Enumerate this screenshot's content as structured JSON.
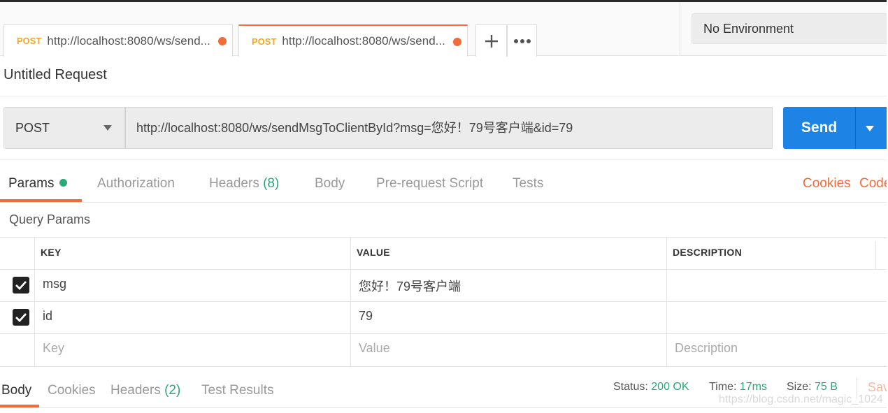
{
  "tabs": [
    {
      "method": "POST",
      "url": "http://localhost:8080/ws/send..."
    },
    {
      "method": "POST",
      "url": "http://localhost:8080/ws/send..."
    }
  ],
  "environment": {
    "selected": "No Environment"
  },
  "request": {
    "title": "Untitled Request",
    "method": "POST",
    "url": "http://localhost:8080/ws/sendMsgToClientById?msg=您好！79号客户端&id=79",
    "send_label": "Send"
  },
  "request_tabs": {
    "params": "Params",
    "authorization": "Authorization",
    "headers": "Headers",
    "headers_count": "(8)",
    "body": "Body",
    "prerequest": "Pre-request Script",
    "tests": "Tests",
    "cookies": "Cookies",
    "code": "Code"
  },
  "query_params": {
    "title": "Query Params",
    "columns": {
      "key": "KEY",
      "value": "VALUE",
      "description": "DESCRIPTION"
    },
    "rows": [
      {
        "checked": true,
        "key": "msg",
        "value": "您好！79号客户端",
        "description": ""
      },
      {
        "checked": true,
        "key": "id",
        "value": "79",
        "description": ""
      }
    ],
    "placeholders": {
      "key": "Key",
      "value": "Value",
      "description": "Description"
    }
  },
  "response": {
    "tabs": {
      "body": "Body",
      "cookies": "Cookies",
      "headers": "Headers",
      "headers_count": "(2)",
      "test_results": "Test Results"
    },
    "status_label": "Status:",
    "status_value": "200 OK",
    "time_label": "Time:",
    "time_value": "17ms",
    "size_label": "Size:",
    "size_value": "75 B",
    "save_label": "Sav"
  },
  "watermark": "https://blog.csdn.net/magic_1024",
  "colors": {
    "accent": "#f26b3a",
    "send": "#1d84e6",
    "green": "#2aa876",
    "method_tab": "#f5a623"
  }
}
